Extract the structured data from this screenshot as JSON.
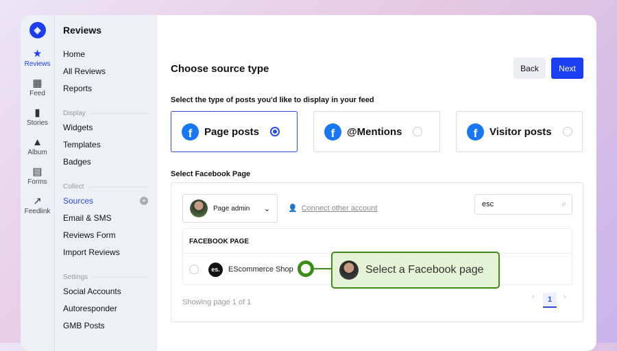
{
  "rail": [
    {
      "label": "Reviews",
      "icon": "star-icon",
      "glyph": "★",
      "active": true
    },
    {
      "label": "Feed",
      "icon": "grid-icon",
      "glyph": "▦"
    },
    {
      "label": "Stories",
      "icon": "stories-icon",
      "glyph": "▮"
    },
    {
      "label": "Album",
      "icon": "image-icon",
      "glyph": "▲"
    },
    {
      "label": "Forms",
      "icon": "clipboard-icon",
      "glyph": "▤"
    },
    {
      "label": "Feedlink",
      "icon": "arrow-up-right-icon",
      "glyph": "↗"
    }
  ],
  "sidebar": {
    "title": "Reviews",
    "main": [
      "Home",
      "All Reviews",
      "Reports"
    ],
    "display_label": "Display",
    "display": [
      "Widgets",
      "Templates",
      "Badges"
    ],
    "collect_label": "Collect",
    "collect": [
      "Sources",
      "Email & SMS",
      "Reviews Form",
      "Import Reviews"
    ],
    "settings_label": "Settings",
    "settings": [
      "Social Accounts",
      "Autoresponder",
      "GMB Posts"
    ]
  },
  "main": {
    "title": "Choose source type",
    "back": "Back",
    "next": "Next",
    "posts_label": "Select the type of posts you'd like to display in your feed",
    "types": [
      {
        "label": "Page posts",
        "selected": true
      },
      {
        "label": "@Mentions",
        "selected": false
      },
      {
        "label": "Visitor posts",
        "selected": false
      }
    ],
    "page_label": "Select Facebook Page",
    "account": "Page admin",
    "connect": "Connect other account",
    "search_value": "esc",
    "table_header": "FACEBOOK PAGE",
    "row": {
      "logo": "es.",
      "name": "EScommerce Shop"
    },
    "showing": "Showing page 1 of 1",
    "page": "1",
    "prev": "‹",
    "nextpg": "›",
    "tooltip": "Select a Facebook page"
  },
  "colors": {
    "accent": "#1b3ef0",
    "tooltip": "#3b8d17"
  }
}
